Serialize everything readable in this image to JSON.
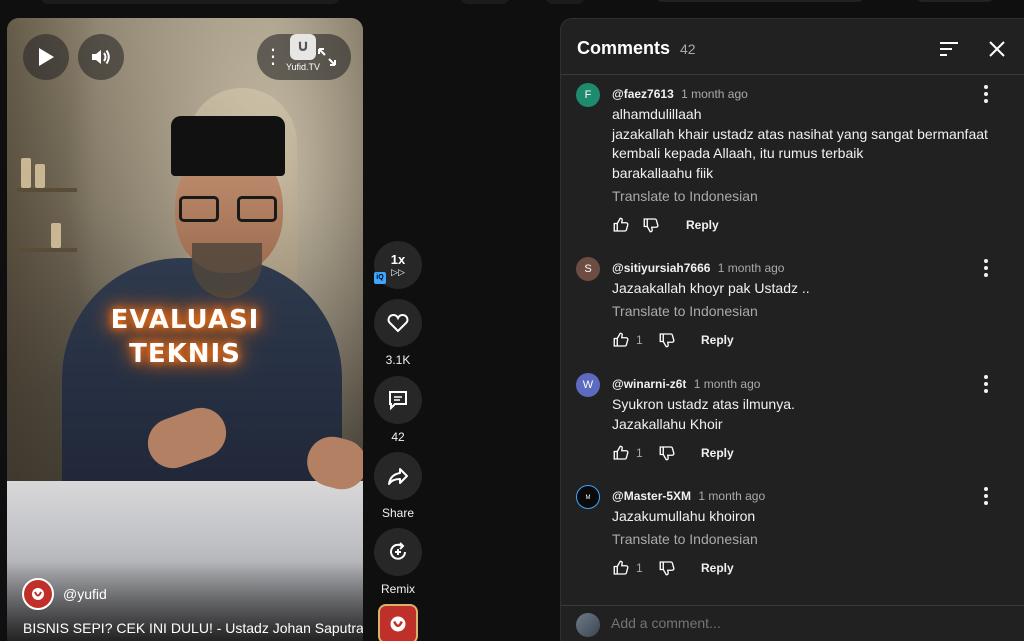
{
  "video": {
    "overlay_line1": "EVALUASI",
    "overlay_line2": "TEKNIS",
    "watermark_text": "Yufid.TV",
    "channel_handle": "@yufid",
    "title": "BISNIS SEPI? CEK INI DULU! - Ustadz Johan Saputra..."
  },
  "actions": {
    "speed": "1x",
    "speed_badge": "iQ",
    "likes": "3.1K",
    "comments_count": "42",
    "share_label": "Share",
    "remix_label": "Remix"
  },
  "comments_panel": {
    "title": "Comments",
    "count": "42",
    "add_placeholder": "Add a comment...",
    "translate_label": "Translate to Indonesian",
    "reply_label": "Reply",
    "comments": [
      {
        "avatar_letter": "F",
        "avatar_color": "#1e8a6e",
        "author": "@faez7613",
        "time": "1 month ago",
        "lines": [
          "alhamdulillaah",
          "jazakallah khair ustadz atas nasihat yang sangat bermanfaat",
          "kembali kepada Allaah, itu rumus terbaik",
          "barakallaahu fiik"
        ],
        "likes": ""
      },
      {
        "avatar_letter": "S",
        "avatar_color": "#6d4c41",
        "author": "@sitiyursiah7666",
        "time": "1 month ago",
        "lines": [
          "Jazaakallah khoyr pak Ustadz .."
        ],
        "likes": "1"
      },
      {
        "avatar_letter": "W",
        "avatar_color": "#5c6bc0",
        "author": "@winarni-z6t",
        "time": "1 month ago",
        "lines": [
          "Syukron ustadz atas ilmunya.",
          "Jazakallahu Khoir"
        ],
        "likes": "1"
      },
      {
        "avatar_letter": "M",
        "avatar_color": "#0a0a0a",
        "author": "@Master-5XM",
        "time": "1 month ago",
        "lines": [
          "Jazakumullahu khoiron"
        ],
        "likes": "1"
      }
    ]
  }
}
